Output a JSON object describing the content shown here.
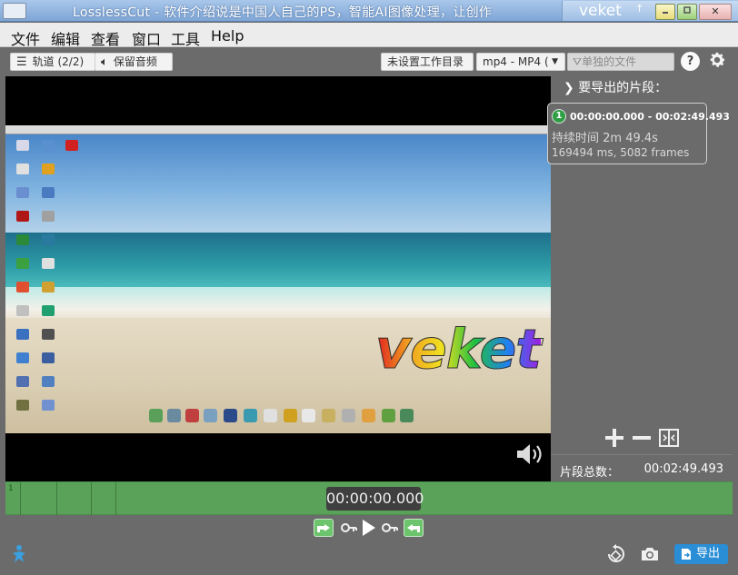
{
  "window": {
    "title": "LosslessCut - 软件介绍说是中国人自己的PS，智能AI图像处理，让创作",
    "user": "veket",
    "up_arrow": "↑",
    "close_glyph": "✕"
  },
  "menu": [
    "文件",
    "编辑",
    "查看",
    "窗口",
    "工具",
    "Help"
  ],
  "toolbar": {
    "tracks_label": "轨道 (2/2)",
    "keep_audio_label": "保留音频",
    "workdir_label": "未设置工作目录",
    "format_value": "mp4 - MP4 (",
    "filename_placeholder": "单独的文件",
    "help_label": "?"
  },
  "video": {
    "overlay_text": "veket"
  },
  "segments": {
    "header": "要导出的片段：",
    "items": [
      {
        "index": "1",
        "range": "00:00:00.000 - 00:02:49.493",
        "duration": "持续时间 2m 49.4s",
        "frames": "169494 ms, 5082 frames"
      }
    ],
    "total_label": "片段总数：",
    "total_value": "00:02:49.493"
  },
  "timeline": {
    "current_time": "00:00:00.000",
    "marker": "1"
  },
  "controls": {
    "export_label": "导出"
  },
  "colors": {
    "background": "#6b6b6b",
    "timeline": "#5aa25a",
    "segment_badge": "#2f9e44",
    "export_button": "#2a8ed6",
    "titlebar": "#7fa6d6"
  }
}
